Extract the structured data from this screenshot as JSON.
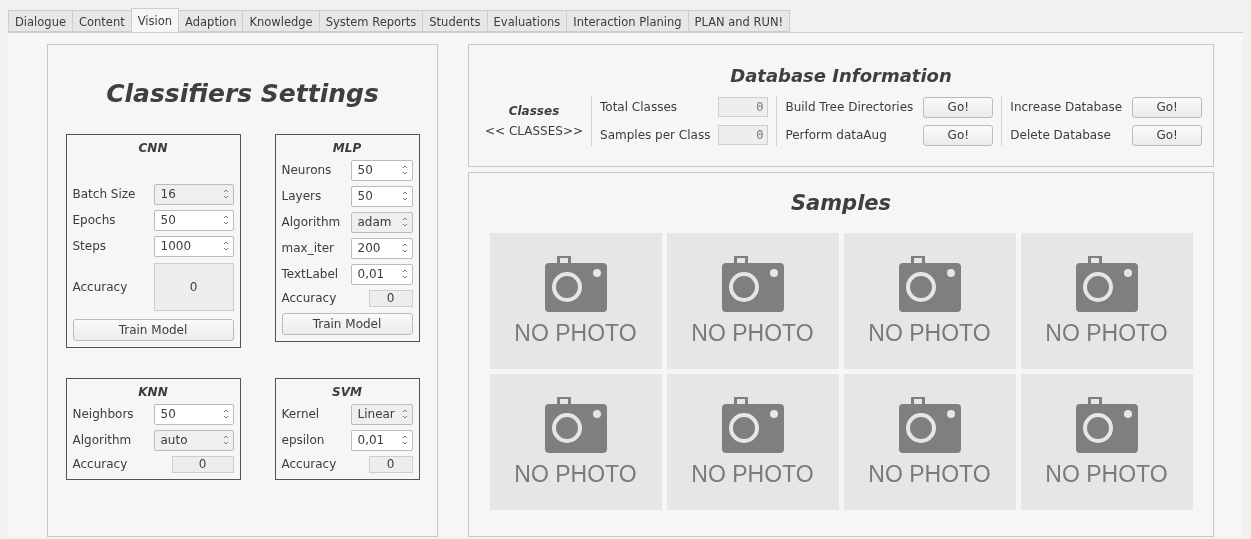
{
  "tabs": [
    {
      "label": "Dialogue",
      "selected": false
    },
    {
      "label": "Content",
      "selected": false
    },
    {
      "label": "Vision",
      "selected": true
    },
    {
      "label": "Adaption",
      "selected": false
    },
    {
      "label": "Knowledge",
      "selected": false
    },
    {
      "label": "System Reports",
      "selected": false
    },
    {
      "label": "Students",
      "selected": false
    },
    {
      "label": "Evaluations",
      "selected": false
    },
    {
      "label": "Interaction Planing",
      "selected": false
    },
    {
      "label": "PLAN and RUN!",
      "selected": false
    }
  ],
  "classifiers": {
    "title": "Classifiers Settings",
    "groups": [
      {
        "title": "CNN",
        "rows": [
          {
            "label": "Batch Size",
            "kind": "combo",
            "value": "16"
          },
          {
            "label": "Epochs",
            "kind": "spin",
            "value": "50"
          },
          {
            "label": "Steps",
            "kind": "spin",
            "value": "1000"
          },
          {
            "label": "Accuracy",
            "kind": "display_large",
            "value": "0"
          }
        ],
        "button": "Train Model"
      },
      {
        "title": "MLP",
        "rows": [
          {
            "label": "Neurons",
            "kind": "spin",
            "value": "50"
          },
          {
            "label": "Layers",
            "kind": "spin",
            "value": "50"
          },
          {
            "label": "Algorithm",
            "kind": "combo",
            "value": "adam"
          },
          {
            "label": "max_iter",
            "kind": "spin",
            "value": "200"
          },
          {
            "label": "TextLabel",
            "kind": "spin",
            "value": "0,01"
          },
          {
            "label": "Accuracy",
            "kind": "display",
            "value": "0"
          }
        ],
        "button": "Train Model"
      },
      {
        "title": "KNN",
        "rows": [
          {
            "label": "Neighbors",
            "kind": "spin",
            "value": "50"
          },
          {
            "label": "Algorithm",
            "kind": "combo",
            "value": "auto"
          },
          {
            "label": "Accuracy",
            "kind": "display",
            "value": "0"
          }
        ]
      },
      {
        "title": "SVM",
        "rows": [
          {
            "label": "Kernel",
            "kind": "combo",
            "value": "Linear"
          },
          {
            "label": "epsilon",
            "kind": "spin",
            "value": "0,01"
          },
          {
            "label": "Accuracy",
            "kind": "display",
            "value": "0"
          }
        ]
      }
    ]
  },
  "database": {
    "title": "Database Information",
    "classes_title": "Classes",
    "classes_value": "<< CLASSES>>",
    "counters": [
      {
        "label": "Total Classes",
        "value": "0"
      },
      {
        "label": "Samples per Class",
        "value": "0"
      }
    ],
    "actions": [
      [
        {
          "label": "Build Tree Directories",
          "button": "Go!"
        },
        {
          "label": "Perform dataAug",
          "button": "Go!"
        }
      ],
      [
        {
          "label": "Increase Database",
          "button": "Go!"
        },
        {
          "label": "Delete Database",
          "button": "Go!"
        }
      ]
    ]
  },
  "samples": {
    "title": "Samples",
    "items": [
      {
        "caption": "NO PHOTO"
      },
      {
        "caption": "NO PHOTO"
      },
      {
        "caption": "NO PHOTO"
      },
      {
        "caption": "NO PHOTO"
      },
      {
        "caption": "NO PHOTO"
      },
      {
        "caption": "NO PHOTO"
      },
      {
        "caption": "NO PHOTO"
      },
      {
        "caption": "NO PHOTO"
      }
    ]
  }
}
